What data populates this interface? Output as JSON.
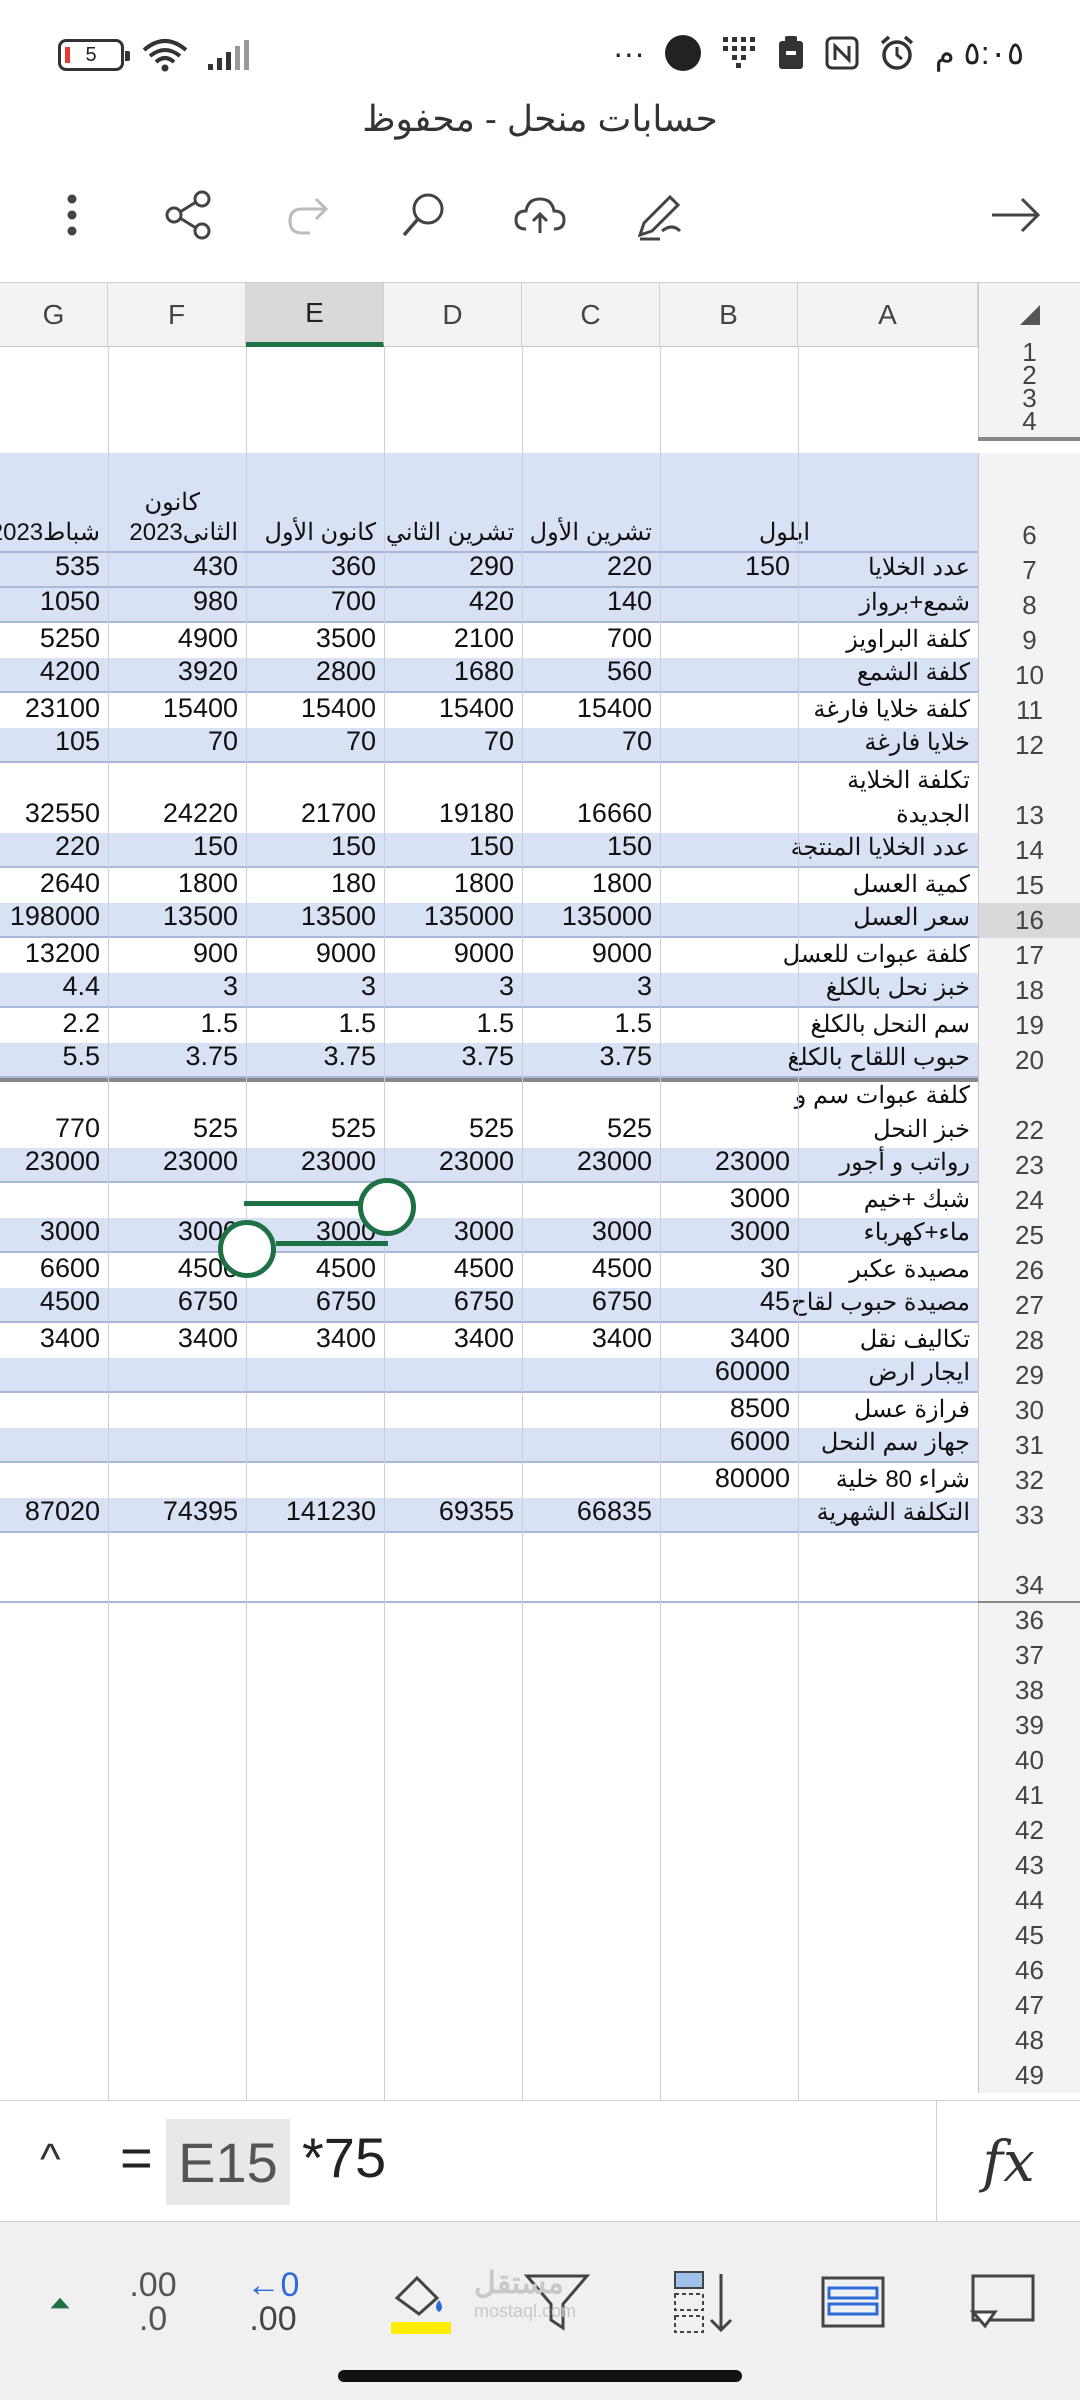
{
  "status_bar": {
    "battery": "5",
    "time": "٥:٠٥ م",
    "more": "···"
  },
  "document": {
    "title": "حسابات منحل - محفوظ"
  },
  "toolbar": {
    "forward_icon": "arrow-right-icon",
    "icons": [
      "more-vertical-icon",
      "share-icon",
      "redo-icon",
      "search-icon",
      "cloud-upload-icon",
      "pen-icon",
      "arrow-right-icon"
    ]
  },
  "columns": [
    "G",
    "F",
    "E",
    "D",
    "C",
    "B",
    "A"
  ],
  "selected_column": "E",
  "header_row": {
    "G": "شباط2023",
    "F_line1": "كانون",
    "F_line2": "الثانى2023",
    "E": "كانون الأول",
    "D": "تشرين الثاني",
    "C": "تشرين الأول",
    "B": "ايلول"
  },
  "rows": [
    {
      "n": "7",
      "A": "عدد الخلايا",
      "B": "150",
      "C": "220",
      "D": "290",
      "E": "360",
      "F": "430",
      "G": "535"
    },
    {
      "n": "8",
      "A": "شمع+برواز",
      "B": "",
      "C": "140",
      "D": "420",
      "E": "700",
      "F": "980",
      "G": "1050"
    },
    {
      "n": "9",
      "A": "كلفة البراويز",
      "B": "",
      "C": "700",
      "D": "2100",
      "E": "3500",
      "F": "4900",
      "G": "5250"
    },
    {
      "n": "10",
      "A": "كلفة الشمع",
      "B": "",
      "C": "560",
      "D": "1680",
      "E": "2800",
      "F": "3920",
      "G": "4200"
    },
    {
      "n": "11",
      "A": "كلفة خلايا فارغة",
      "B": "",
      "C": "15400",
      "D": "15400",
      "E": "15400",
      "F": "15400",
      "G": "23100"
    },
    {
      "n": "12",
      "A": "خلايا فارغة",
      "B": "",
      "C": "70",
      "D": "70",
      "E": "70",
      "F": "70",
      "G": "105"
    },
    {
      "n": "13",
      "A": "تكلفة الخلاية",
      "A2": "الجديدة",
      "B": "",
      "C": "16660",
      "D": "19180",
      "E": "21700",
      "F": "24220",
      "G": "32550"
    },
    {
      "n": "14",
      "A": "عدد الخلايا المنتجة",
      "B": "",
      "C": "150",
      "D": "150",
      "E": "150",
      "F": "150",
      "G": "220"
    },
    {
      "n": "15",
      "A": "كمية العسل",
      "B": "",
      "C": "1800",
      "D": "1800",
      "E": "180",
      "F": "1800",
      "G": "2640"
    },
    {
      "n": "16",
      "A": "سعر العسل",
      "B": "",
      "C": "135000",
      "D": "135000",
      "E": "13500",
      "F": "13500",
      "G": "198000"
    },
    {
      "n": "17",
      "A": "كلفة عبوات للعسل",
      "B": "",
      "C": "9000",
      "D": "9000",
      "E": "9000",
      "F": "900",
      "G": "13200"
    },
    {
      "n": "18",
      "A": "خبز نحل بالكلغ",
      "B": "",
      "C": "3",
      "D": "3",
      "E": "3",
      "F": "3",
      "G": "4.4"
    },
    {
      "n": "19",
      "A": "سم النحل بالكلغ",
      "B": "",
      "C": "1.5",
      "D": "1.5",
      "E": "1.5",
      "F": "1.5",
      "G": "2.2"
    },
    {
      "n": "20",
      "A": "حبوب اللقاح بالكلغ",
      "B": "",
      "C": "3.75",
      "D": "3.75",
      "E": "3.75",
      "F": "3.75",
      "G": "5.5"
    },
    {
      "n": "22",
      "A": "كلفة عبوات سم و",
      "A2": "خبز النحل",
      "B": "",
      "C": "525",
      "D": "525",
      "E": "525",
      "F": "525",
      "G": "770"
    },
    {
      "n": "23",
      "A": "رواتب و أجور",
      "B": "23000",
      "C": "23000",
      "D": "23000",
      "E": "23000",
      "F": "23000",
      "G": "23000"
    },
    {
      "n": "24",
      "A": "شبك +خيم",
      "B": "3000",
      "C": "",
      "D": "",
      "E": "",
      "F": "",
      "G": ""
    },
    {
      "n": "25",
      "A": "ماء+كهرباء",
      "B": "3000",
      "C": "3000",
      "D": "3000",
      "E": "3000",
      "F": "3000",
      "G": "3000"
    },
    {
      "n": "26",
      "A": "مصيدة عكبر",
      "B": "30",
      "C": "4500",
      "D": "4500",
      "E": "4500",
      "F": "4500",
      "G": "6600"
    },
    {
      "n": "27",
      "A": "مصيدة حبوب لقاح",
      "B": "45",
      "C": "6750",
      "D": "6750",
      "E": "6750",
      "F": "6750",
      "G": "4500"
    },
    {
      "n": "28",
      "A": "تكاليف نقل",
      "B": "3400",
      "C": "3400",
      "D": "3400",
      "E": "3400",
      "F": "3400",
      "G": "3400"
    },
    {
      "n": "29",
      "A": "ايجار ارض",
      "B": "60000",
      "C": "",
      "D": "",
      "E": "",
      "F": "",
      "G": ""
    },
    {
      "n": "30",
      "A": "فرازة عسل",
      "B": "8500",
      "C": "",
      "D": "",
      "E": "",
      "F": "",
      "G": ""
    },
    {
      "n": "31",
      "A": "جهاز سم النحل",
      "B": "6000",
      "C": "",
      "D": "",
      "E": "",
      "F": "",
      "G": ""
    },
    {
      "n": "32",
      "A": "شراء 80 خلية",
      "B": "80000",
      "C": "",
      "D": "",
      "E": "",
      "F": "",
      "G": ""
    },
    {
      "n": "33",
      "A": "التكلفة الشهرية",
      "B": "",
      "C": "66835",
      "D": "69355",
      "E": "141230",
      "F": "74395",
      "G": "87020"
    }
  ],
  "row_headers_top": [
    "1",
    "2",
    "3",
    "4",
    "6"
  ],
  "row_headers_bottom": [
    "34",
    "36",
    "37",
    "38",
    "39",
    "40",
    "41",
    "42",
    "43",
    "44",
    "45",
    "46",
    "47",
    "48",
    "49"
  ],
  "formula_bar": {
    "collapse": "^",
    "equals": "=",
    "reference": "E15",
    "rest": "*75",
    "fx": "fx"
  },
  "bottom_toolbar": {
    "decrease_decimal_top": ".00",
    "decrease_decimal_bottom": ".0",
    "increase_decimal_top": "←0",
    "increase_decimal_bottom": ".00",
    "highlight_color": "#ffeb00",
    "icons": [
      "expand-up-icon",
      "decrease-decimal-icon",
      "increase-decimal-icon",
      "fill-color-icon",
      "filter-icon",
      "sort-icon",
      "freeze-panes-icon",
      "comment-icon"
    ]
  },
  "watermark": {
    "text": "مستقل",
    "sub": "mostaql.com"
  },
  "colors": {
    "accent": "#1e7145",
    "band": "#d9e1f4",
    "selected_header": "#d9d9d9"
  }
}
